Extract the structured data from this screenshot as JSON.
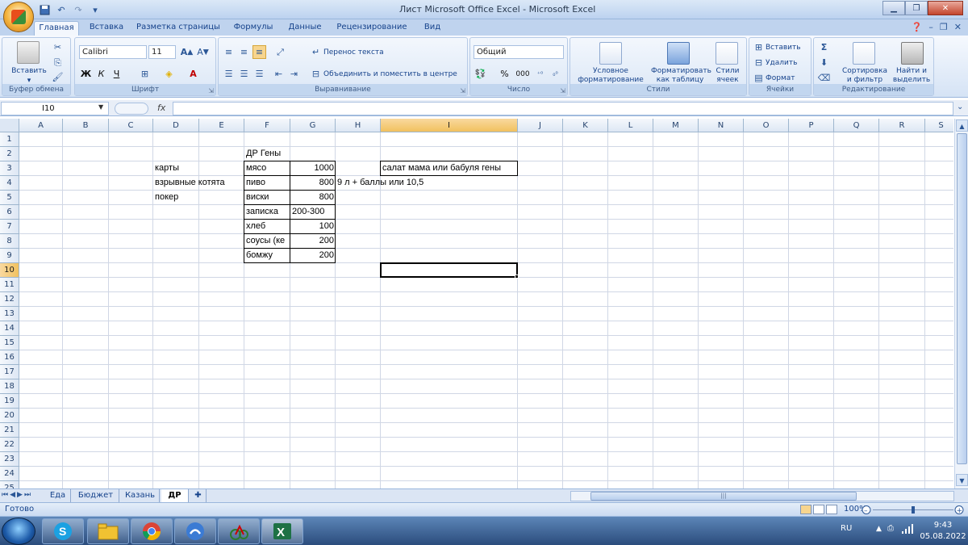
{
  "window": {
    "title": "Лист Microsoft Office Excel - Microsoft Excel"
  },
  "ribbon_tabs": [
    "Главная",
    "Вставка",
    "Разметка страницы",
    "Формулы",
    "Данные",
    "Рецензирование",
    "Вид"
  ],
  "active_tab": "Главная",
  "groups": {
    "clipboard": {
      "label": "Буфер обмена",
      "paste": "Вставить"
    },
    "font": {
      "label": "Шрифт",
      "font_name": "Calibri",
      "font_size": "11",
      "bold": "Ж",
      "italic": "К",
      "underline": "Ч"
    },
    "alignment": {
      "label": "Выравнивание",
      "wrap": "Перенос текста",
      "merge": "Объединить и поместить в центре"
    },
    "number": {
      "label": "Число",
      "format": "Общий",
      "percent": "%",
      "thousands": "000"
    },
    "styles": {
      "label": "Стили",
      "conditional": "Условное форматирование",
      "as_table": "Форматировать как таблицу",
      "cell_styles": "Стили ячеек"
    },
    "cells": {
      "label": "Ячейки",
      "insert": "Вставить",
      "delete": "Удалить",
      "format": "Формат"
    },
    "editing": {
      "label": "Редактирование",
      "sort": "Сортировка и фильтр",
      "find": "Найти и выделить"
    }
  },
  "formula_bar": {
    "name_box": "I10",
    "fx": "fx",
    "formula": ""
  },
  "columns": [
    "A",
    "B",
    "C",
    "D",
    "E",
    "F",
    "G",
    "H",
    "I",
    "J",
    "K",
    "L",
    "M",
    "N",
    "O",
    "P",
    "Q",
    "R",
    "S"
  ],
  "selected_column": "I",
  "rows": [
    "1",
    "2",
    "3",
    "4",
    "5",
    "6",
    "7",
    "8",
    "9",
    "10",
    "11",
    "12",
    "13",
    "14",
    "15",
    "16",
    "17",
    "18",
    "19",
    "20",
    "21",
    "22",
    "23",
    "24",
    "25"
  ],
  "selected_row": "10",
  "cells": {
    "D3": "карты",
    "D4": "взрывные котята",
    "D5": "покер",
    "F2": "ДР Гены",
    "F3": "мясо",
    "G3": "1000",
    "F4": "пиво",
    "G4": "800",
    "H4": "9 л + баллы или 10,5",
    "F5": "виски",
    "G5": "800",
    "F6": "записка",
    "G6": "200-300",
    "F7": "хлеб",
    "G7": "100",
    "F8": "соусы (ке",
    "G8": "200",
    "F9": "бомжу",
    "G9": "200",
    "I3": "салат мама или бабуля гены"
  },
  "sheets": [
    "Еда",
    "Бюджет",
    "Казань",
    "ДР"
  ],
  "active_sheet": "ДР",
  "status": {
    "ready": "Готово",
    "zoom": "100%"
  },
  "taskbar": {
    "lang": "RU",
    "time": "9:43",
    "date": "05.08.2022"
  },
  "colors": {
    "selection_header": "#f1c15f",
    "excel_green": "#1e7145",
    "ribbon_blue": "#15428b"
  }
}
